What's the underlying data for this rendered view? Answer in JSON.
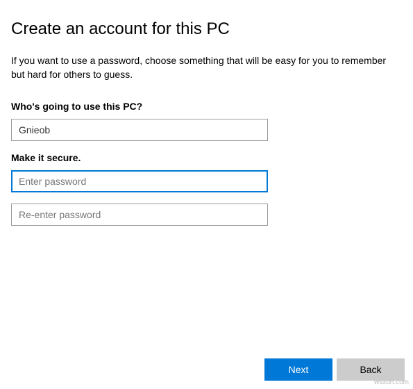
{
  "header": {
    "title": "Create an account for this PC",
    "description": "If you want to use a password, choose something that will be easy for you to remember but hard for others to guess."
  },
  "form": {
    "username_section_label": "Who's going to use this PC?",
    "username_value": "Gnieob",
    "password_section_label": "Make it secure.",
    "password_placeholder": "Enter password",
    "password_value": "",
    "confirm_password_placeholder": "Re-enter password",
    "confirm_password_value": ""
  },
  "footer": {
    "next_label": "Next",
    "back_label": "Back"
  },
  "watermark": "wsxdn.com"
}
